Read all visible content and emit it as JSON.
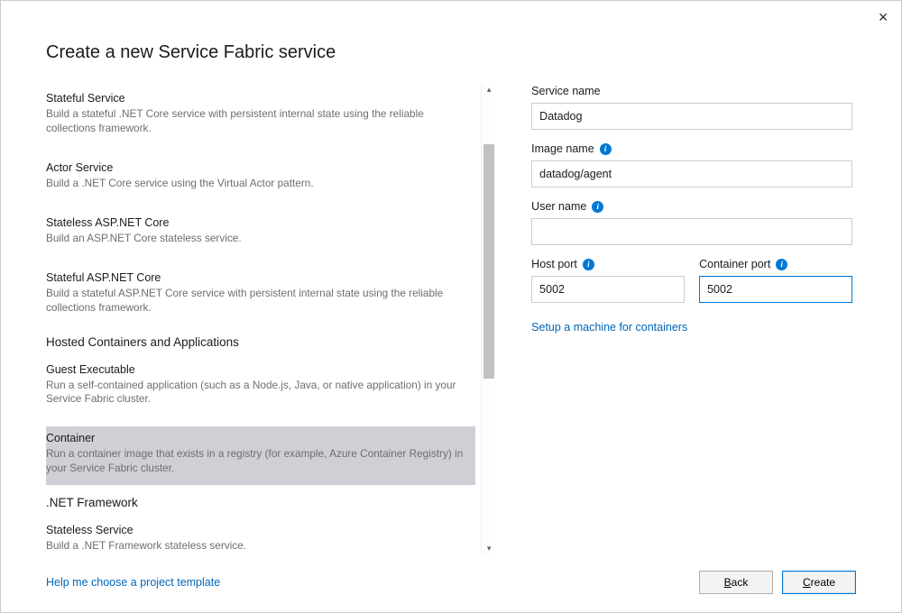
{
  "dialog": {
    "title": "Create a new Service Fabric service",
    "close_tooltip": "Close"
  },
  "left": {
    "cat0": {
      "item0": {
        "title": "Stateful Service",
        "desc": "Build a stateful .NET Core service with persistent internal state using the reliable collections framework."
      },
      "item1": {
        "title": "Actor Service",
        "desc": "Build a .NET Core service using the Virtual Actor pattern."
      },
      "item2": {
        "title": "Stateless ASP.NET Core",
        "desc": "Build an ASP.NET Core stateless service."
      },
      "item3": {
        "title": "Stateful ASP.NET Core",
        "desc": "Build a stateful ASP.NET Core service with persistent internal state using the reliable collections framework."
      }
    },
    "cat1": {
      "header": "Hosted Containers and Applications",
      "item0": {
        "title": "Guest Executable",
        "desc": "Run a self-contained application (such as a Node.js, Java, or native application) in your Service Fabric cluster."
      },
      "item1": {
        "title": "Container",
        "desc": "Run a container image that exists in a registry (for example, Azure Container Registry) in your Service Fabric cluster."
      }
    },
    "cat2": {
      "header": ".NET Framework",
      "item0": {
        "title": "Stateless Service",
        "desc": "Build a .NET Framework stateless service."
      }
    }
  },
  "right": {
    "service_name_label": "Service name",
    "service_name_value": "Datadog",
    "image_name_label": "Image name",
    "image_name_value": "datadog/agent",
    "user_name_label": "User name",
    "user_name_value": "",
    "host_port_label": "Host port",
    "host_port_value": "5002",
    "container_port_label": "Container port",
    "container_port_value": "5002",
    "setup_link": "Setup a machine for containers"
  },
  "footer": {
    "help_link": "Help me choose a project template",
    "back_label": "Back",
    "back_mnemonic": "B",
    "create_label": "Create",
    "create_mnemonic": "C"
  }
}
